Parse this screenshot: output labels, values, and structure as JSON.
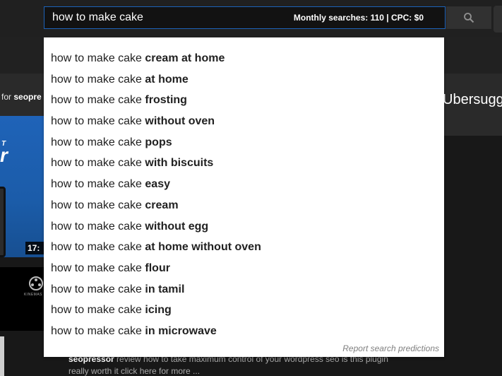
{
  "search": {
    "query": "how to make cake",
    "meta": "Monthly searches: 110 | CPC: $0",
    "button_icon": "search-icon"
  },
  "background": {
    "banner_left_prefix": "for",
    "banner_left_bold": "seopre",
    "banner_right": "Ubersugg",
    "thumb_t": "T",
    "thumb_r": "r",
    "thumb_time": "17:",
    "kine_label": "KINEMAS",
    "desc_bold": "seopressor",
    "desc_line1": " review how to take maximum control of your wordpress seo is this plugin",
    "desc_line2": "really worth it click here for more ..."
  },
  "suggestions": {
    "items": [
      {
        "base": "how to make cake",
        "completion": " cream at home"
      },
      {
        "base": "how to make cake",
        "completion": " at home"
      },
      {
        "base": "how to make cake",
        "completion": " frosting"
      },
      {
        "base": "how to make cake",
        "completion": " without oven"
      },
      {
        "base": "how to make cake",
        "completion": " pops"
      },
      {
        "base": "how to make cake",
        "completion": " with biscuits"
      },
      {
        "base": "how to make cake",
        "completion": " easy"
      },
      {
        "base": "how to make cake",
        "completion": " cream"
      },
      {
        "base": "how to make cake",
        "completion": " without egg"
      },
      {
        "base": "how to make cake",
        "completion": " at home without oven"
      },
      {
        "base": "how to make cake",
        "completion": " flour"
      },
      {
        "base": "how to make cake",
        "completion": " in tamil"
      },
      {
        "base": "how to make cake",
        "completion": " icing"
      },
      {
        "base": "how to make cake",
        "completion": " in microwave"
      }
    ],
    "report_label": "Report search predictions"
  },
  "colors": {
    "accent_border": "#1c62b9",
    "page_bg": "#181818"
  }
}
